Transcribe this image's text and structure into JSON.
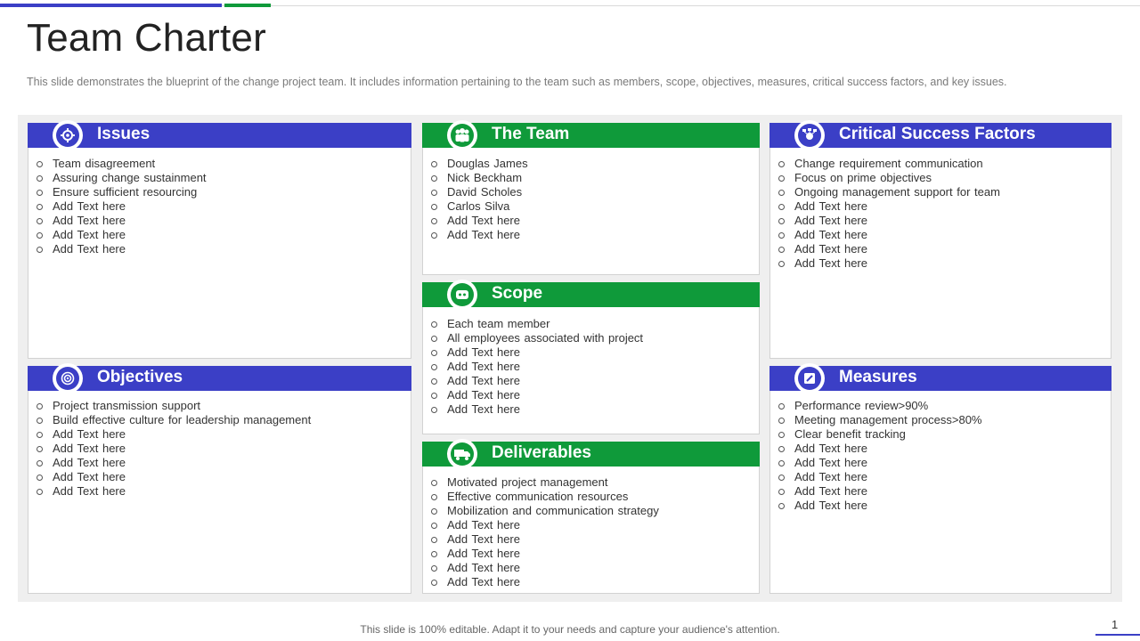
{
  "header": {
    "title": "Team Charter",
    "subtitle": "This slide demonstrates the blueprint of the change project team. It includes information pertaining to the team such as members, scope, objectives, measures, critical success factors, and key issues."
  },
  "colors": {
    "blue": "#3b3fc6",
    "green": "#0f9a3a"
  },
  "cards": {
    "issues": {
      "title": "Issues",
      "icon": "gear-icon",
      "items": [
        "Team disagreement",
        "Assuring change sustainment",
        "Ensure sufficient resourcing",
        "Add Text here",
        "Add Text here",
        "Add Text here",
        "Add Text here"
      ]
    },
    "team": {
      "title": "The Team",
      "icon": "people-icon",
      "items": [
        "Douglas James",
        "Nick Beckham",
        "David Scholes",
        "Carlos Silva",
        "Add Text here",
        "Add Text here"
      ]
    },
    "csf": {
      "title": "Critical Success Factors",
      "icon": "network-icon",
      "items": [
        "Change requirement communication",
        "Focus on prime objectives",
        "Ongoing management support for team",
        "Add Text here",
        "Add Text here",
        "Add Text here",
        "Add Text here",
        "Add Text here"
      ]
    },
    "scope": {
      "title": "Scope",
      "icon": "scope-icon",
      "items": [
        "Each team member",
        "All employees associated with project",
        "Add Text here",
        "Add Text here",
        "Add Text here",
        "Add Text here",
        "Add Text here"
      ]
    },
    "objectives": {
      "title": "Objectives",
      "icon": "target-icon",
      "items": [
        "Project transmission support",
        "Build effective  culture for leadership management",
        "Add Text here",
        "Add Text here",
        "Add Text here",
        "Add Text here",
        "Add Text here"
      ]
    },
    "measures": {
      "title": "Measures",
      "icon": "edit-icon",
      "items": [
        "Performance  review>90%",
        "Meeting management  process>80%",
        "Clear benefit tracking",
        "Add Text here",
        "Add Text here",
        "Add Text here",
        "Add Text here",
        "Add Text here"
      ]
    },
    "deliverables": {
      "title": "Deliverables",
      "icon": "truck-icon",
      "items": [
        "Motivated project management",
        "Effective communication resources",
        "Mobilization and communication strategy",
        "Add Text here",
        "Add Text here",
        "Add Text here",
        "Add Text here",
        "Add Text here"
      ]
    }
  },
  "footer": {
    "note": "This slide is 100% editable. Adapt it to your needs and capture your audience's attention.",
    "page_number": "1"
  }
}
